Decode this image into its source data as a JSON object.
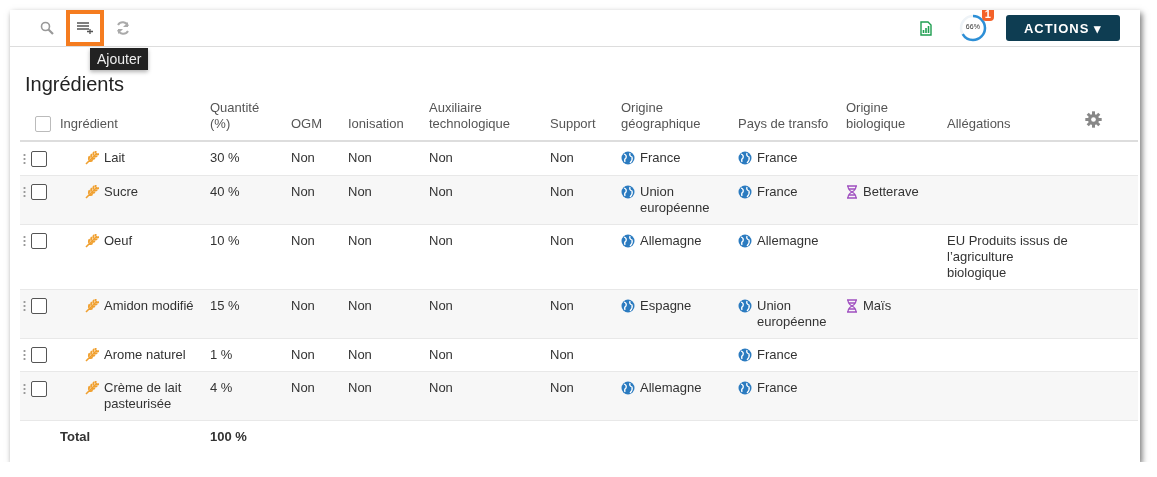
{
  "toolbar": {
    "tooltip": "Ajouter",
    "progress": {
      "label": "66%",
      "badge": "1"
    },
    "actions_button": "ACTIONS ▾"
  },
  "title": "Ingrédients",
  "table": {
    "header_checked": false,
    "columns": [
      "Ingrédient",
      "Quantité (%)",
      "OGM",
      "Ionisation",
      "Auxiliaire technologique",
      "Support",
      "Origine géographique",
      "Pays de transfo",
      "Origine biologique",
      "Allégations"
    ],
    "rows": [
      {
        "checked": false,
        "ingredient": "Lait",
        "quantite": "30 %",
        "ogm": "Non",
        "ionisation": "Non",
        "auxiliaire": "Non",
        "support": "Non",
        "origine_geo": "France",
        "pays_transfo": "France"
      },
      {
        "checked": false,
        "ingredient": "Sucre",
        "quantite": "40 %",
        "ogm": "Non",
        "ionisation": "Non",
        "auxiliaire": "Non",
        "support": "Non",
        "origine_geo": "Union européenne",
        "pays_transfo": "France",
        "origine_bio": "Betterave"
      },
      {
        "checked": false,
        "ingredient": "Oeuf",
        "quantite": "10 %",
        "ogm": "Non",
        "ionisation": "Non",
        "auxiliaire": "Non",
        "support": "Non",
        "origine_geo": "Allemagne",
        "pays_transfo": "Allemagne",
        "allegations": "EU Produits issus de l’agriculture biologique"
      },
      {
        "checked": false,
        "ingredient": "Amidon modifié",
        "quantite": "15 %",
        "ogm": "Non",
        "ionisation": "Non",
        "auxiliaire": "Non",
        "support": "Non",
        "origine_geo": "Espagne",
        "pays_transfo": "Union européenne",
        "origine_bio": "Maïs"
      },
      {
        "checked": false,
        "ingredient": "Arome naturel",
        "quantite": "1 %",
        "ogm": "Non",
        "ionisation": "Non",
        "auxiliaire": "Non",
        "support": "Non",
        "pays_transfo": "France"
      },
      {
        "checked": false,
        "ingredient": "Crème de lait pasteurisée",
        "quantite": "4 %",
        "ogm": "Non",
        "ionisation": "Non",
        "auxiliaire": "Non",
        "support": "Non",
        "origine_geo": "Allemagne",
        "pays_transfo": "France"
      }
    ],
    "total": {
      "label": "Total",
      "quantite": "100 %"
    }
  }
}
